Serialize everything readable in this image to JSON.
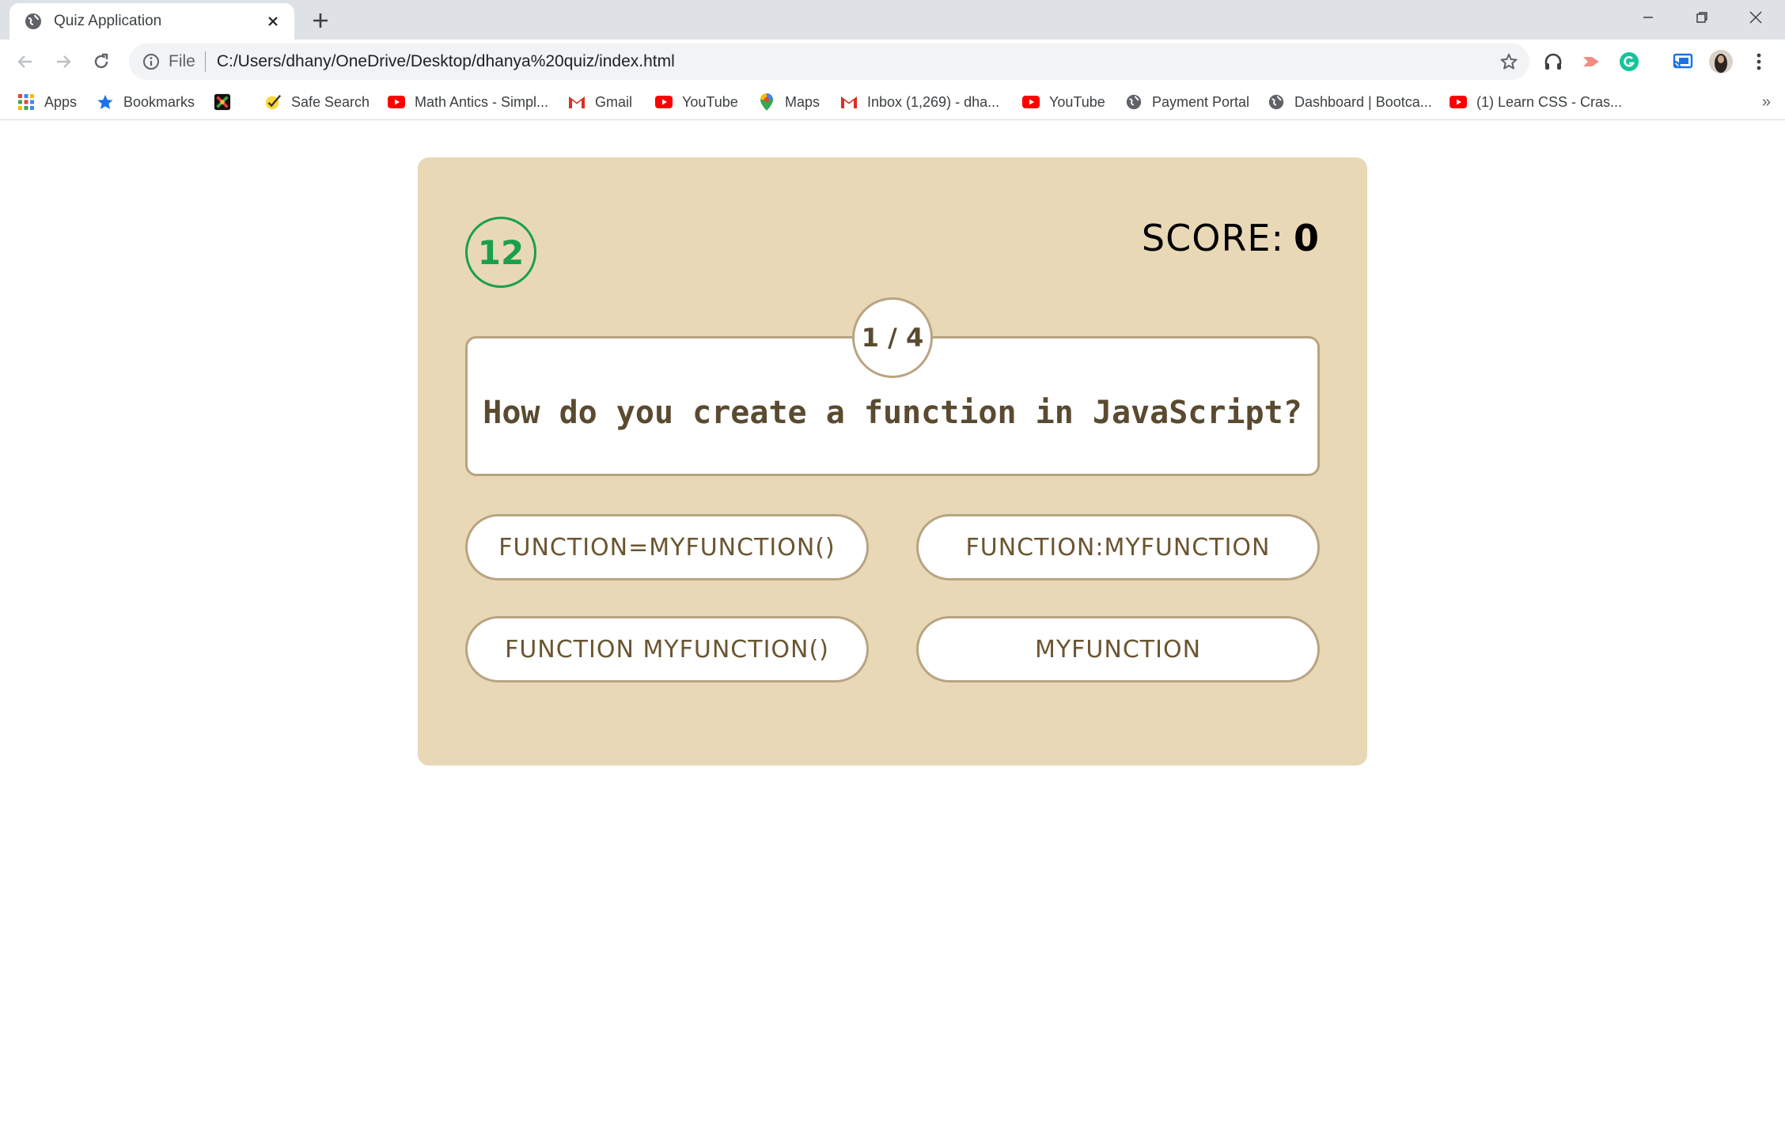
{
  "browser": {
    "tab_title": "Quiz Application",
    "address_scheme": "File",
    "url": "C:/Users/dhany/OneDrive/Desktop/dhanya%20quiz/index.html"
  },
  "bookmarks": [
    {
      "label": "Apps",
      "icon": "apps-grid-icon"
    },
    {
      "label": "Bookmarks",
      "icon": "star-icon"
    },
    {
      "label": "",
      "icon": "colorful-x-icon"
    },
    {
      "label": "Safe Search",
      "icon": "safe-search-check-icon"
    },
    {
      "label": "Math Antics - Simpl...",
      "icon": "youtube-icon"
    },
    {
      "label": "Gmail",
      "icon": "gmail-icon"
    },
    {
      "label": "YouTube",
      "icon": "youtube-icon"
    },
    {
      "label": "Maps",
      "icon": "maps-pin-icon"
    },
    {
      "label": "Inbox (1,269) - dha...",
      "icon": "gmail-icon"
    },
    {
      "label": "YouTube",
      "icon": "youtube-icon"
    },
    {
      "label": "Payment Portal",
      "icon": "globe-icon"
    },
    {
      "label": "Dashboard | Bootca...",
      "icon": "globe-icon"
    },
    {
      "label": "(1) Learn CSS - Cras...",
      "icon": "youtube-icon"
    }
  ],
  "bookmarks_more": "»",
  "colors": {
    "card": "#e9d8b6",
    "border": "#b8a482",
    "timer": "#1aa04a",
    "text_brown": "#5a4a30"
  },
  "quiz": {
    "timer": "12",
    "score_label": "SCORE:",
    "score_value": "0",
    "counter": "1 / 4",
    "question": "How do you create a function in JavaScript?",
    "options": [
      "FUNCTION=MYFUNCTION()",
      "FUNCTION:MYFUNCTION",
      "FUNCTION MYFUNCTION()",
      "MYFUNCTION"
    ]
  }
}
